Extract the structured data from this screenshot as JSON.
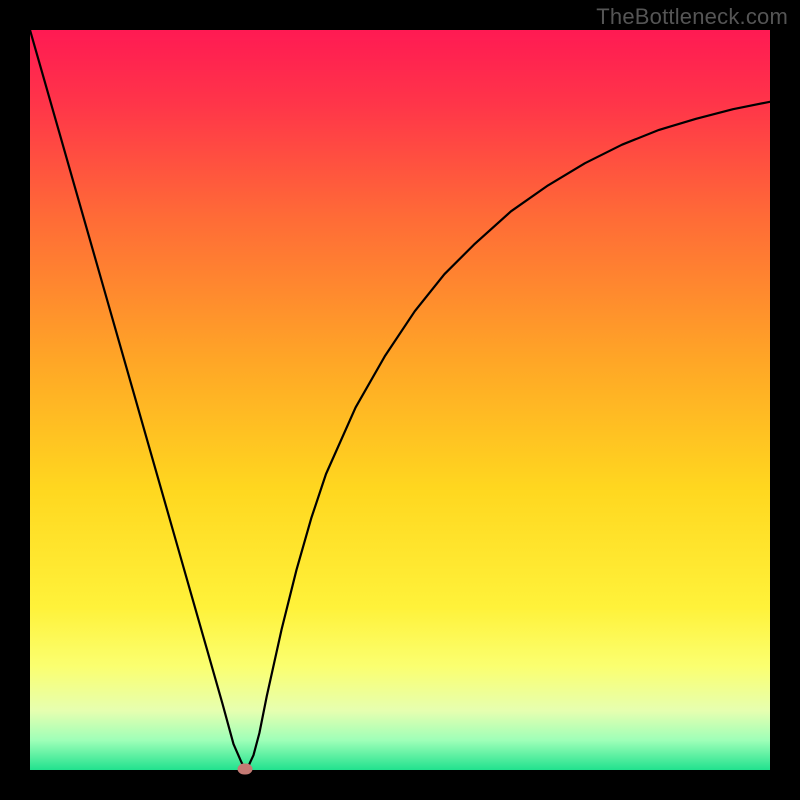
{
  "watermark": "TheBottleneck.com",
  "chart_data": {
    "type": "line",
    "title": "",
    "xlabel": "",
    "ylabel": "",
    "xlim": [
      0,
      100
    ],
    "ylim": [
      0,
      100
    ],
    "grid": false,
    "legend": false,
    "background_gradient": {
      "stops": [
        {
          "pct": 0,
          "color": "#ff1a53"
        },
        {
          "pct": 10,
          "color": "#ff3549"
        },
        {
          "pct": 25,
          "color": "#ff6a37"
        },
        {
          "pct": 45,
          "color": "#ffa726"
        },
        {
          "pct": 62,
          "color": "#ffd71f"
        },
        {
          "pct": 78,
          "color": "#fff23a"
        },
        {
          "pct": 86,
          "color": "#fbff70"
        },
        {
          "pct": 92,
          "color": "#e6ffb0"
        },
        {
          "pct": 96,
          "color": "#9effb8"
        },
        {
          "pct": 100,
          "color": "#21e28e"
        }
      ]
    },
    "series": [
      {
        "name": "bottleneck-curve",
        "color": "#000000",
        "x": [
          0,
          2,
          4,
          6,
          8,
          10,
          12,
          14,
          16,
          18,
          20,
          22,
          24,
          26,
          27.5,
          28.5,
          29,
          29.5,
          30.2,
          31,
          32,
          34,
          36,
          38,
          40,
          44,
          48,
          52,
          56,
          60,
          65,
          70,
          75,
          80,
          85,
          90,
          95,
          100
        ],
        "y": [
          100,
          93,
          86,
          79,
          72,
          65,
          58,
          51,
          44,
          37,
          30,
          23,
          16,
          9,
          3.5,
          1.2,
          0.2,
          0.5,
          2.0,
          5,
          10,
          19,
          27,
          34,
          40,
          49,
          56,
          62,
          67,
          71,
          75.5,
          79,
          82,
          84.5,
          86.5,
          88,
          89.3,
          90.3
        ]
      }
    ],
    "marker": {
      "x": 29.0,
      "y": 0.2,
      "color": "#c57a74"
    }
  }
}
